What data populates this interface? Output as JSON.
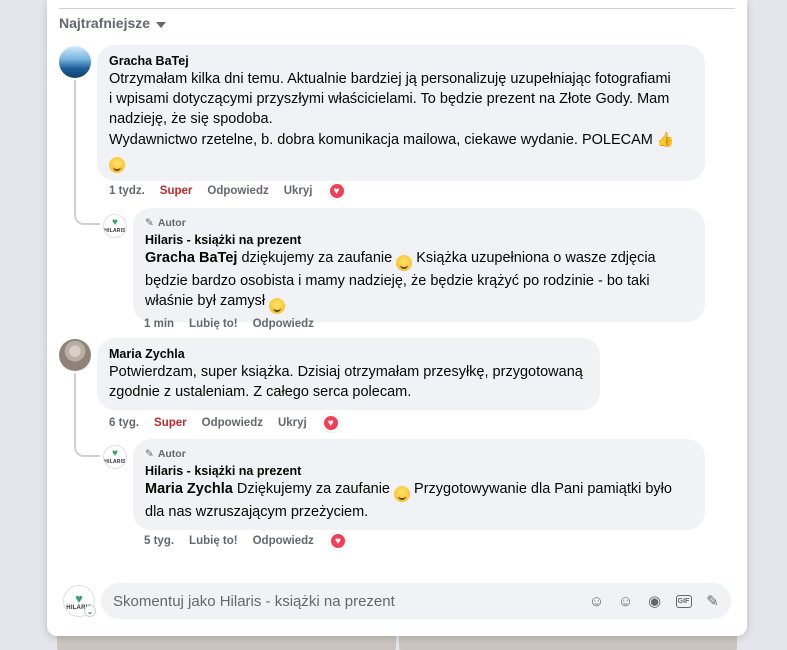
{
  "sort": {
    "label": "Najtrafniejsze"
  },
  "comments": [
    {
      "author": "Gracha BaTej",
      "lines": [
        "Otrzymałam kilka dni temu. Aktualnie bardziej ją personalizuję uzupełniając fotografiami",
        "i wpisami dotyczącymi przyszłymi właścicielami. To będzie prezent na Złote Gody. Mam",
        "nadzieję, że się spodoba.",
        "Wydawnictwo rzetelne, b. dobra komunikacja mailowa, ciekawe wydanie. POLECAM"
      ],
      "time": "1 tydz.",
      "reaction_label": "Super",
      "reply_label": "Odpowiedz",
      "hide_label": "Ukryj",
      "reply": {
        "badge": "Autor",
        "author": "Hilaris - książki na prezent",
        "mention": "Gracha BaTej",
        "text_1": " dziękujemy za zaufanie ",
        "text_2": " Książka uzupełniona o wasze zdjęcia",
        "line_2": "będzie bardzo osobista i mamy nadzieję, że będzie krążyć po rodzinie - bo taki",
        "line_3": "właśnie był zamysł ",
        "time": "1 min",
        "like_label": "Lubię to!",
        "reply_label": "Odpowiedz"
      }
    },
    {
      "author": "Maria Zychla",
      "lines": [
        "Potwierdzam, super książka. Dzisiaj otrzymałam przesyłkę, przygotowaną",
        "zgodnie z ustaleniam. Z całego serca polecam."
      ],
      "time": "6 tyg.",
      "reaction_label": "Super",
      "reply_label": "Odpowiedz",
      "hide_label": "Ukryj",
      "reply": {
        "badge": "Autor",
        "author": "Hilaris - książki na prezent",
        "mention": "Maria Zychla",
        "text_1": " Dziękujemy za zaufanie ",
        "text_2": " Przygotowywanie dla Pani pamiątki było",
        "line_2": "dla nas wzruszającym przeżyciem.",
        "time": "5 tyg.",
        "like_label": "Lubię to!",
        "reply_label": "Odpowiedz"
      }
    }
  ],
  "brand": {
    "avatar_text": "HILARIS"
  },
  "composer": {
    "placeholder": "Skomentuj jako Hilaris - książki na prezent"
  },
  "colors": {
    "super": "#c0282d",
    "love": "#f33e58",
    "bubble": "#f0f2f5"
  }
}
